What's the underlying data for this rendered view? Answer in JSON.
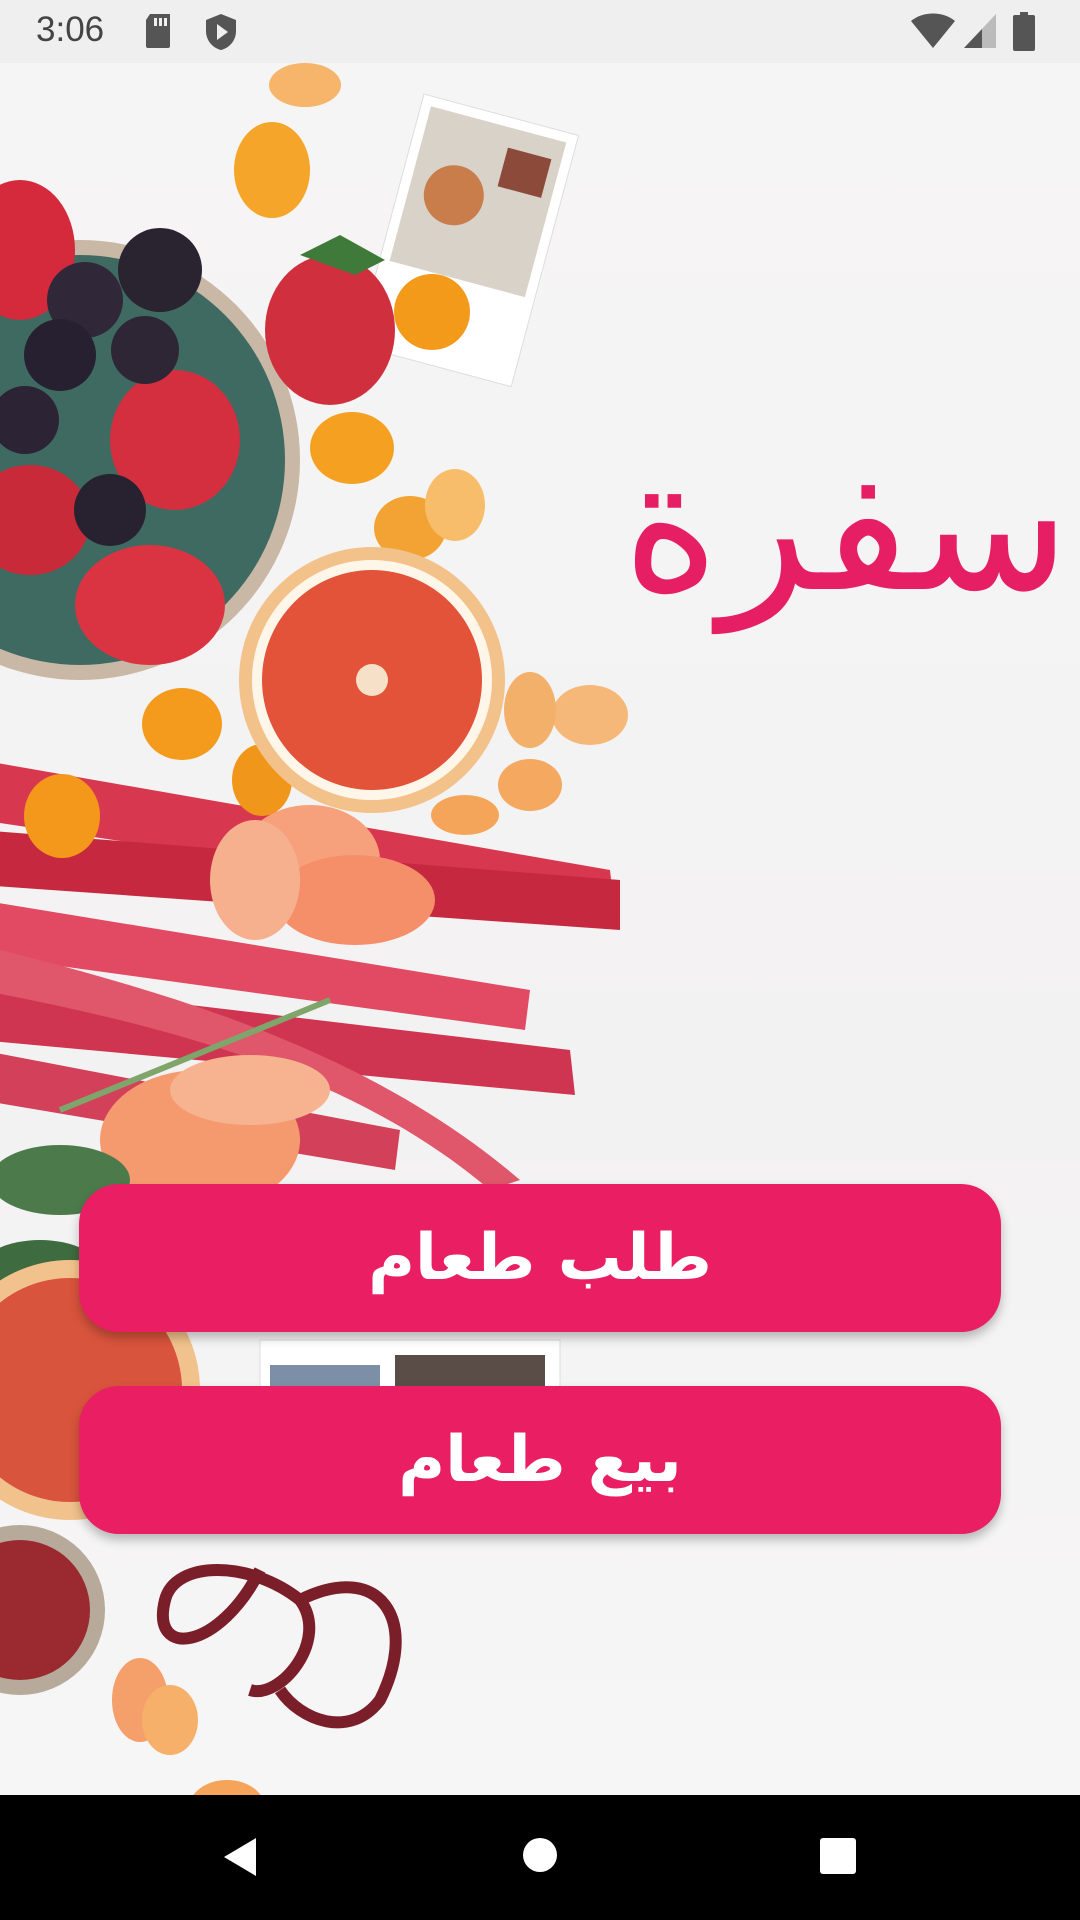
{
  "status_bar": {
    "time": "3:06",
    "icons": [
      "sd-card-icon",
      "play-protect-icon",
      "wifi-icon",
      "signal-icon",
      "battery-icon"
    ]
  },
  "app": {
    "title": "سفرة",
    "buttons": {
      "order_food": "طلب طعام",
      "sell_food": "بيع طعام"
    },
    "accent_color": "#e91e63"
  },
  "nav_bar": {
    "icons": [
      "back-icon",
      "home-icon",
      "recents-icon"
    ]
  }
}
